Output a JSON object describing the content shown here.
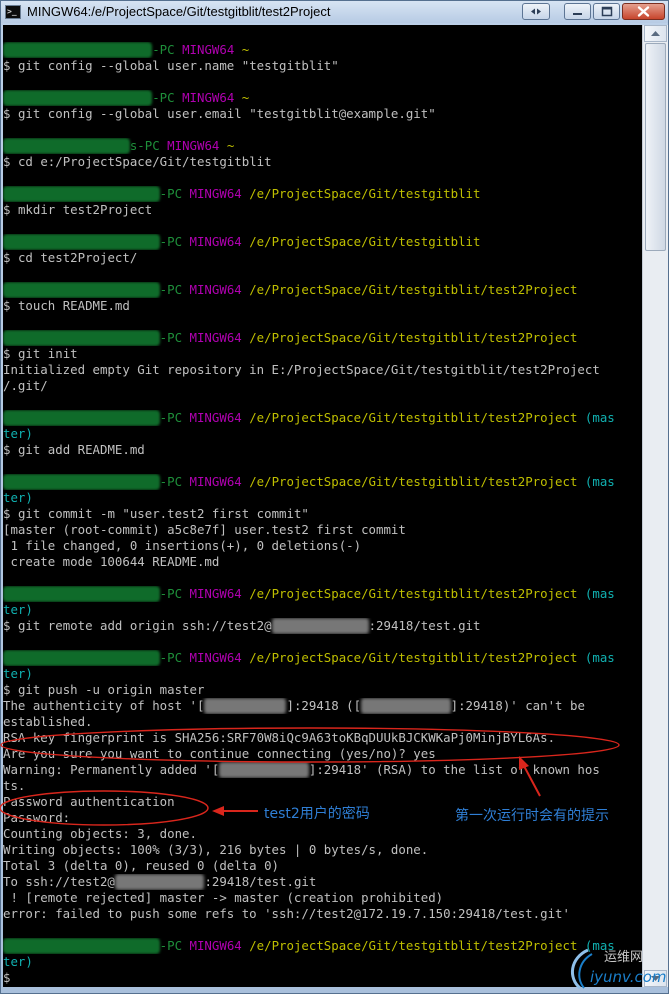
{
  "window": {
    "title": "MINGW64:/e/ProjectSpace/Git/testgitblit/test2Project"
  },
  "prompt": {
    "user_suffix": "-PC",
    "shell": "MINGW64",
    "branch_a": "(mas",
    "branch_b": "ter)",
    "dollar": "$"
  },
  "session": {
    "home": "~",
    "cmd_config_name": "git config --global user.name \"testgitblit\"",
    "cmd_config_email": "git config --global user.email \"testgitblit@example.git\"",
    "cmd_cd_repo": "cd e:/ProjectSpace/Git/testgitblit",
    "path_repo": "/e/ProjectSpace/Git/testgitblit",
    "cmd_mkdir": "mkdir test2Project",
    "cmd_cd_project": "cd test2Project/",
    "path_project": "/e/ProjectSpace/Git/testgitblit/test2Project",
    "cmd_touch": "touch README.md",
    "cmd_init": "git init",
    "out_init_1": "Initialized empty Git repository in E:/ProjectSpace/Git/testgitblit/test2Project",
    "out_init_2": "/.git/",
    "cmd_add": "git add README.md",
    "cmd_commit": "git commit -m \"user.test2 first commit\"",
    "out_commit_1": "[master (root-commit) a5c8e7f] user.test2 first commit",
    "out_commit_2": " 1 file changed, 0 insertions(+), 0 deletions(-)",
    "out_commit_3": " create mode 100644 README.md",
    "cmd_remote_pre": "git remote add origin ssh://test2@",
    "cmd_remote_post": ":29418/test.git",
    "cmd_push": "git push -u origin master",
    "out_auth_pre": "The authenticity of host '[",
    "out_auth_mid": "]:29418 ([",
    "out_auth_post": "]:29418)' can't be",
    "out_established": "established.",
    "out_fingerprint": "RSA key fingerprint is SHA256:SRF70W8iQc9A63toKBqDUUkBJCKWKaPj0MinjBYL6As.",
    "out_continue": "Are you sure you want to continue connecting (yes/no)? yes",
    "out_warning_pre": "Warning: Permanently added '[",
    "out_warning_post": "]:29418' (RSA) to the list of known hos",
    "out_warning_2": "ts.",
    "out_password_auth": "Password authentication",
    "out_password": "Password:",
    "out_counting": "Counting objects: 3, done.",
    "out_writing": "Writing objects: 100% (3/3), 216 bytes | 0 bytes/s, done.",
    "out_total": "Total 3 (delta 0), reused 0 (delta 0)",
    "out_to_pre": "To ssh://test2@",
    "out_to_post": ":29418/test.git",
    "out_rejected": " ! [remote rejected] master -> master (creation prohibited)",
    "out_error": "error: failed to push some refs to 'ssh://test2@172.19.7.150:29418/test.git'"
  },
  "annotations": {
    "password_note": "test2用户的密码",
    "first_run_note": "第一次运行时会有的提示",
    "color": "#2f7fd6",
    "oval_color": "#d9261c"
  },
  "watermark": {
    "site": "运维网",
    "domain": "iyunv.com"
  }
}
